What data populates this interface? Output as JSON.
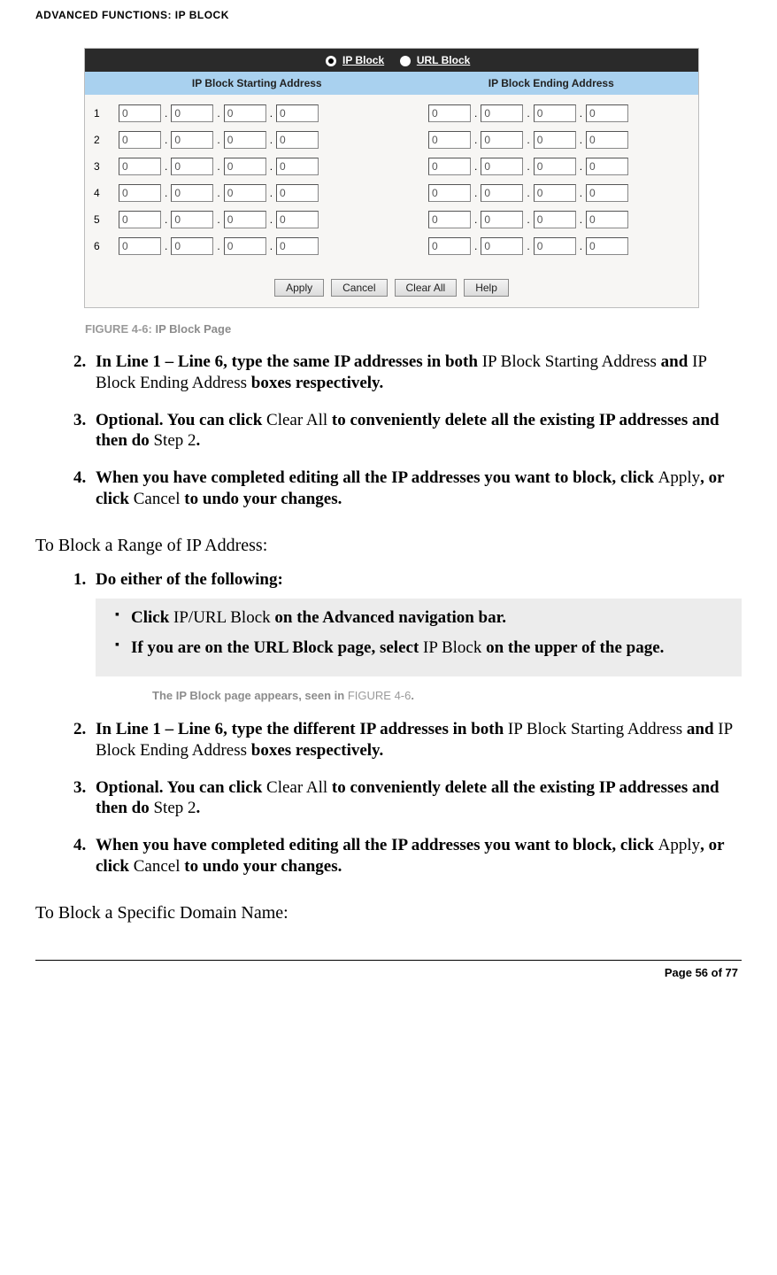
{
  "header": {
    "title": "ADVANCED FUNCTIONS: IP BLOCK"
  },
  "ipblock": {
    "radio_ip": "IP Block",
    "radio_url": "URL Block",
    "col_start": "IP Block Starting Address",
    "col_end": "IP Block Ending Address",
    "rows": [
      {
        "idx": "1",
        "s": [
          "0",
          "0",
          "0",
          "0"
        ],
        "e": [
          "0",
          "0",
          "0",
          "0"
        ]
      },
      {
        "idx": "2",
        "s": [
          "0",
          "0",
          "0",
          "0"
        ],
        "e": [
          "0",
          "0",
          "0",
          "0"
        ]
      },
      {
        "idx": "3",
        "s": [
          "0",
          "0",
          "0",
          "0"
        ],
        "e": [
          "0",
          "0",
          "0",
          "0"
        ]
      },
      {
        "idx": "4",
        "s": [
          "0",
          "0",
          "0",
          "0"
        ],
        "e": [
          "0",
          "0",
          "0",
          "0"
        ]
      },
      {
        "idx": "5",
        "s": [
          "0",
          "0",
          "0",
          "0"
        ],
        "e": [
          "0",
          "0",
          "0",
          "0"
        ]
      },
      {
        "idx": "6",
        "s": [
          "0",
          "0",
          "0",
          "0"
        ],
        "e": [
          "0",
          "0",
          "0",
          "0"
        ]
      }
    ],
    "btn_apply": "Apply",
    "btn_cancel": "Cancel",
    "btn_clear": "Clear All",
    "btn_help": "Help"
  },
  "caption": {
    "label": "FIGURE 4-6:",
    "title": "IP Block Page"
  },
  "stepsA": {
    "s2a": "In Line 1 – Line 6, type the same IP addresses in both ",
    "s2b": "IP Block Starting Address ",
    "s2c": "and ",
    "s2d": "IP Block Ending Address ",
    "s2e": "boxes respectively.",
    "s3a": "Optional. You can click ",
    "s3b": "Clear All ",
    "s3c": "to conveniently delete all the existing IP addresses and then do ",
    "s3d": "Step 2",
    "s3e": ".",
    "s4a": "When you have completed editing all the IP addresses you want to block, click ",
    "s4b": "Apply",
    "s4c": ", or click ",
    "s4d": "Cancel ",
    "s4e": "to undo your changes."
  },
  "sectionB": {
    "heading": "To Block a Range of IP Address:"
  },
  "stepsB": {
    "s1": "Do either of the following:",
    "b1a": "Click ",
    "b1b": "IP/URL Block ",
    "b1c": "on the Advanced navigation bar.",
    "b2a": "If you are on the URL Block page, select ",
    "b2b": "IP Block ",
    "b2c": "on the upper of the page.",
    "appears_a": "The IP Block page appears, seen in ",
    "appears_b": "FIGURE 4-6",
    "appears_c": ".",
    "s2a": "In Line 1 – Line 6, type the different IP addresses in both ",
    "s2b": "IP Block Starting Address ",
    "s2c": "and ",
    "s2d": "IP Block Ending Address ",
    "s2e": "boxes respectively.",
    "s3a": "Optional. You can click ",
    "s3b": "Clear All ",
    "s3c": "to conveniently delete all the existing IP addresses and then do ",
    "s3d": "Step 2",
    "s3e": ".",
    "s4a": "When you have completed editing all the IP addresses you want to block, click ",
    "s4b": "Apply",
    "s4c": ", or click ",
    "s4d": "Cancel ",
    "s4e": "to undo your changes."
  },
  "sectionC": {
    "heading": "To Block a Specific Domain Name:"
  },
  "footer": {
    "page": "Page 56 of 77"
  }
}
